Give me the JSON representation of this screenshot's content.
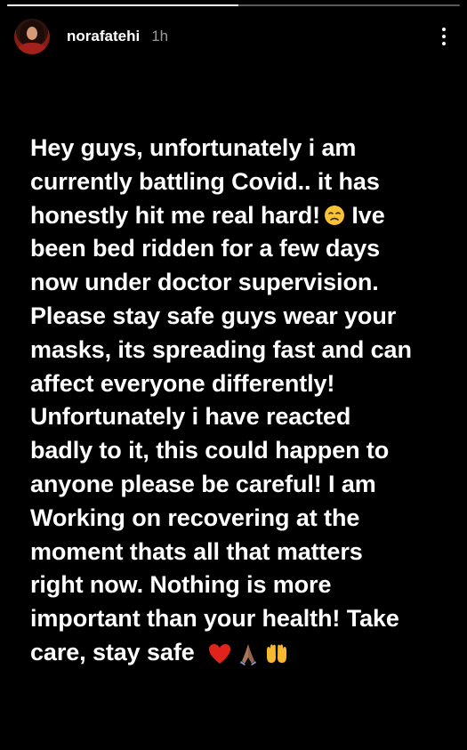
{
  "story": {
    "progress": 0.51,
    "username": "norafatehi",
    "timestamp": "1h",
    "text_line1": "Hey guys, unfortunately i am\ncurrently battling Covid.. it has\nhonestly hit me real hard!",
    "text_line2": " Ive\nbeen bed ridden for a few days\nnow under doctor supervision.\nPlease stay safe guys wear your\nmasks, its spreading fast and can\naffect everyone differently!\nUnfortunately i have reacted\nbadly to it, this could happen to\nanyone please be careful! I am\nWorking on recovering at the\nmoment thats all that matters\nright now. Nothing is more\nimportant than your health! Take\ncare, stay safe",
    "emojis": [
      "disappointed-face-icon",
      "red-heart-icon",
      "folded-hands-icon",
      "open-hands-icon"
    ]
  },
  "colors": {
    "background": "#000000",
    "text": "#ffffff",
    "timestamp": "#9a9a9a",
    "heart": "#e0241b",
    "face": "#f7c233"
  }
}
